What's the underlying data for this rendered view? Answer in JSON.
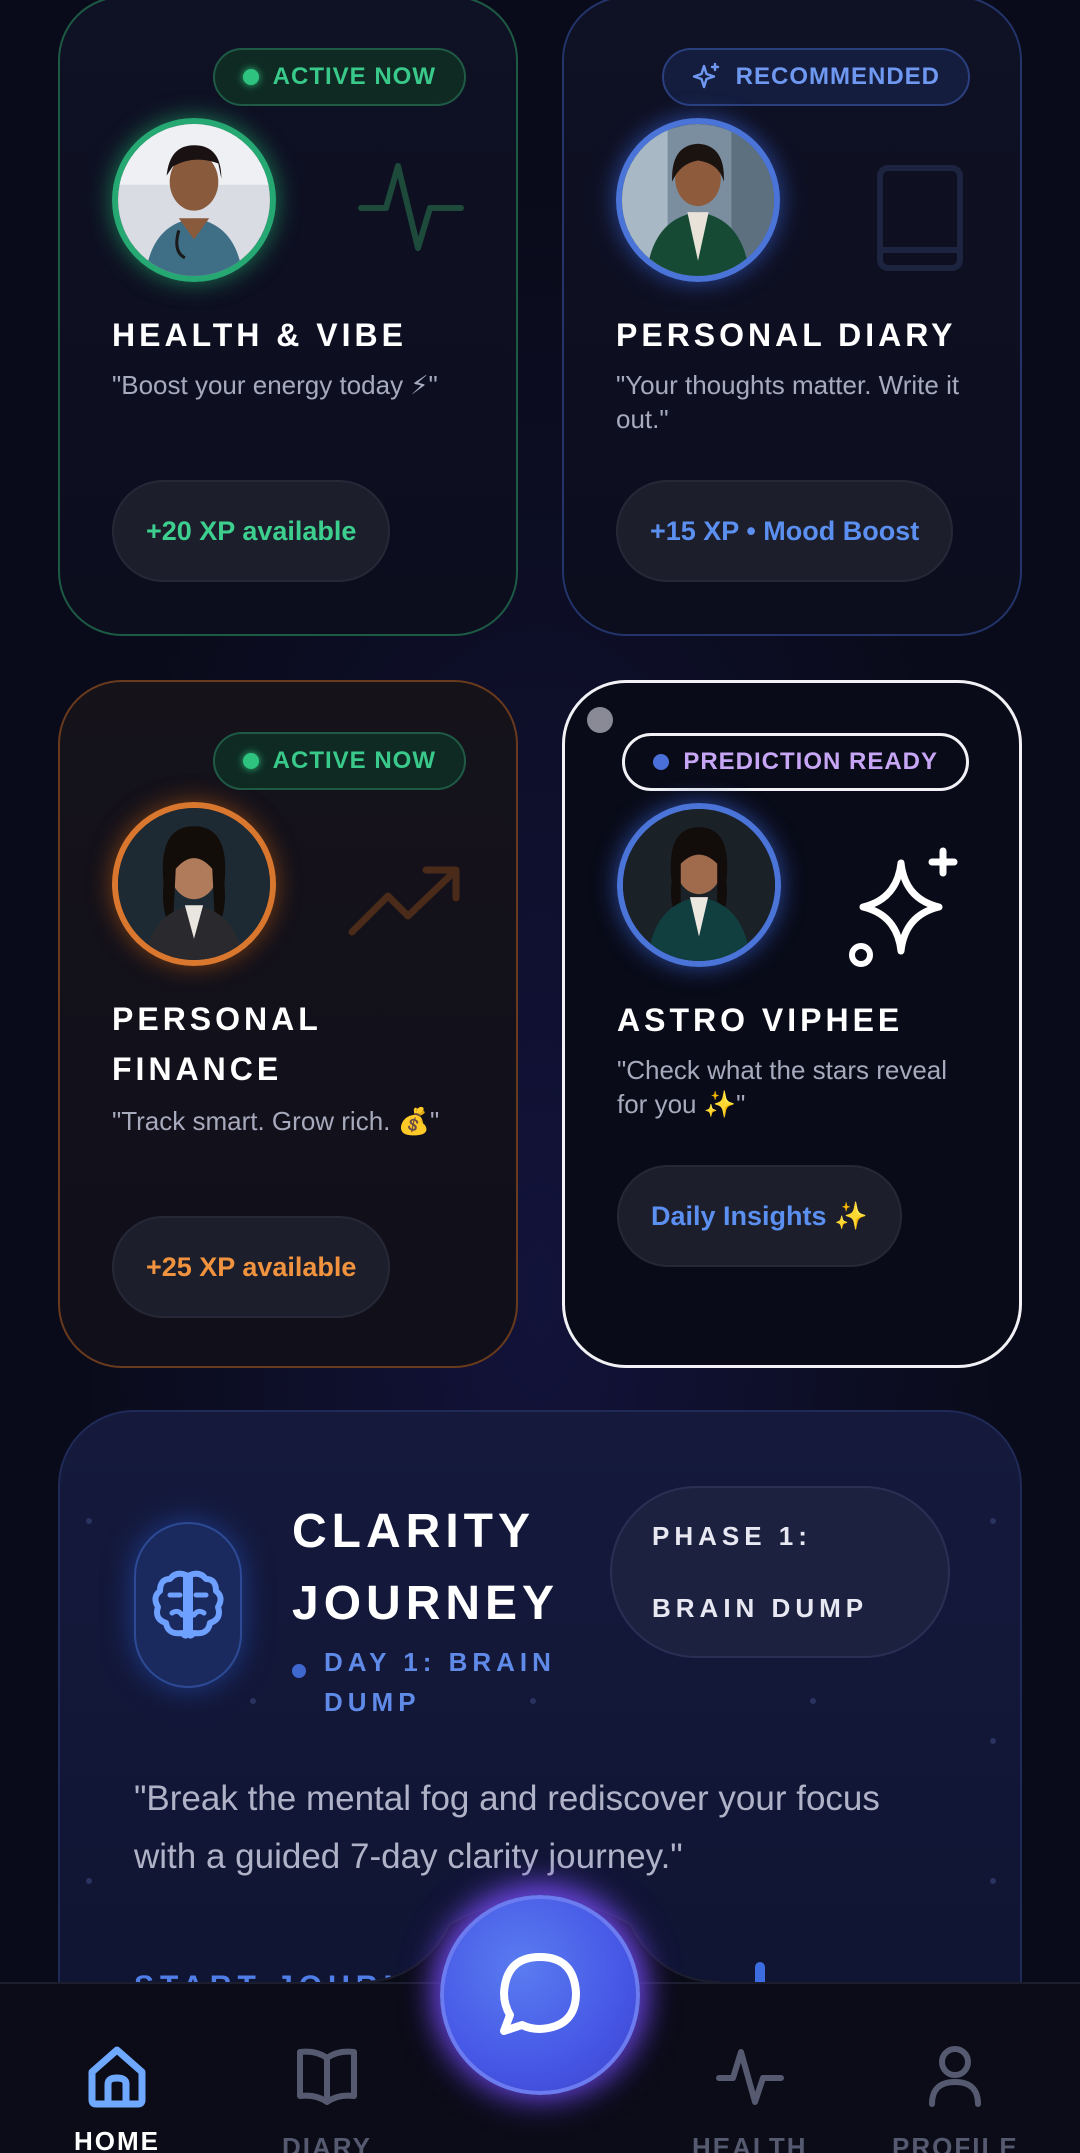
{
  "cards": [
    {
      "badge": "ACTIVE NOW",
      "title": "HEALTH & VIBE",
      "quote": "\"Boost your energy today ⚡\"",
      "pill": "+20 XP available",
      "avatar": "doctor-avatar",
      "deco": "pulse-icon"
    },
    {
      "badge": "RECOMMENDED",
      "title": "PERSONAL DIARY",
      "quote": "\"Your thoughts matter. Write it out.\"",
      "pill": "+15 XP • Mood Boost",
      "avatar": "diarist-avatar",
      "deco": "book-icon"
    },
    {
      "badge": "ACTIVE NOW",
      "title": "PERSONAL FINANCE",
      "quote": "\"Track smart. Grow rich. 💰\"",
      "pill": "+25 XP available",
      "avatar": "finance-avatar",
      "deco": "trending-up-icon"
    },
    {
      "badge": "PREDICTION READY",
      "title": "ASTRO VIPHEE",
      "quote": "\"Check what the stars reveal for you ✨\"",
      "pill": "Daily Insights ✨",
      "avatar": "astro-avatar",
      "deco": "sparkle-icon"
    }
  ],
  "clarity": {
    "title": "CLARITY JOURNEY",
    "day": "DAY 1: BRAIN DUMP",
    "phase": "PHASE 1: BRAIN DUMP",
    "quote": "\"Break the mental fog and rediscover your focus with a guided 7-day clarity journey.\"",
    "cta": "START JOURNEY"
  },
  "nav": {
    "home": "HOME",
    "diary": "DIARY",
    "health": "HEALTH",
    "profile": "PROFILE"
  },
  "colors": {
    "green": "#2ec47f",
    "blue": "#4a74d8",
    "orange": "#d9772e",
    "purple": "#c7a6f5",
    "accent": "#4657e6"
  }
}
